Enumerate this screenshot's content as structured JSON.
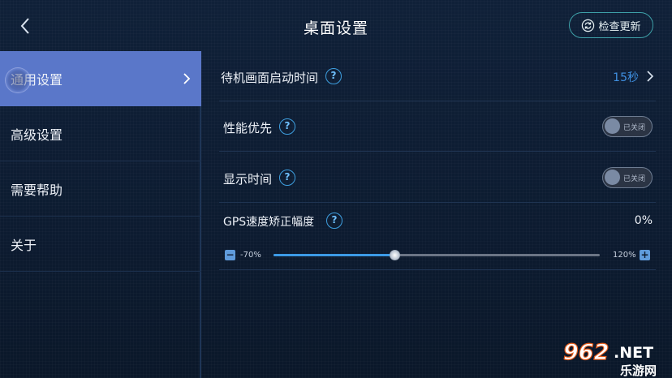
{
  "header": {
    "title": "桌面设置",
    "check_update_label": "检查更新"
  },
  "sidebar": {
    "items": [
      {
        "label": "通用设置",
        "active": true
      },
      {
        "label": "高级设置",
        "active": false
      },
      {
        "label": "需要帮助",
        "active": false
      },
      {
        "label": "关于",
        "active": false
      }
    ]
  },
  "settings": {
    "standby": {
      "label": "待机画面启动时间",
      "help": "?",
      "value": "15秒"
    },
    "performance": {
      "label": "性能优先",
      "help": "?",
      "toggle_label": "已关闭",
      "on": false
    },
    "show_time": {
      "label": "显示时间",
      "help": "?",
      "toggle_label": "已关闭",
      "on": false
    },
    "gps": {
      "label": "GPS速度矫正幅度",
      "help": "?",
      "value": "0%",
      "min_label": "-70%",
      "max_label": "120%",
      "minus": "−",
      "plus": "+",
      "slider_fraction": 0.37
    }
  },
  "watermark": {
    "text1": "962.NET",
    "text2": "乐游网"
  },
  "colors": {
    "accent": "#5a77c9",
    "link_blue": "#3f8fe0",
    "track_fill": "#3c9ae6",
    "button_border": "#3ea0a8"
  }
}
